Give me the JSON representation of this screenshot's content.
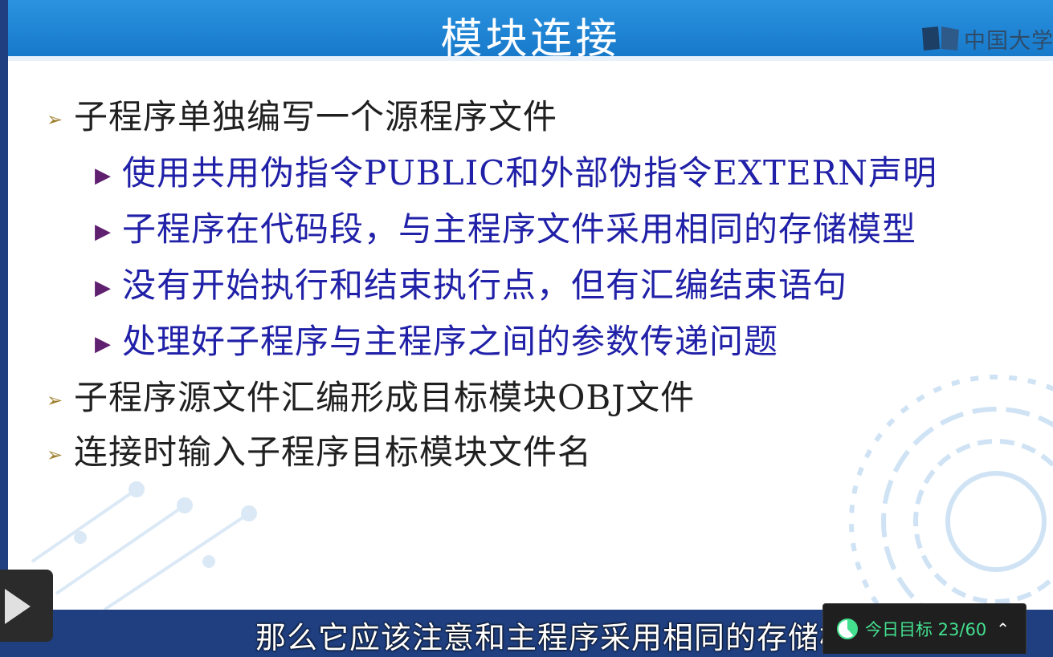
{
  "slide": {
    "title": "模块连接",
    "logo_text": "中国大学",
    "bullets": [
      {
        "level": 1,
        "text": "子程序单独编写一个源程序文件"
      },
      {
        "level": 2,
        "text": "使用共用伪指令PUBLIC和外部伪指令EXTERN声明"
      },
      {
        "level": 2,
        "text": "子程序在代码段，与主程序文件采用相同的存储模型"
      },
      {
        "level": 2,
        "text": "没有开始执行和结束执行点，但有汇编结束语句"
      },
      {
        "level": 2,
        "text": "处理好子程序与主程序之间的参数传递问题"
      },
      {
        "level": 1,
        "text": "子程序源文件汇编形成目标模块OBJ文件"
      },
      {
        "level": 1,
        "text": "连接时输入子程序目标模块文件名"
      }
    ]
  },
  "player": {
    "subtitle": "那么它应该注意和主程序采用相同的存储模",
    "goal_label": "今日目标 23/60",
    "goal_progress": 0.3833
  },
  "colors": {
    "title_bar": "#1f84d6",
    "level2_text": "#2020a8",
    "goal_text": "#43e08f"
  },
  "icons": [
    "logo-book-icon",
    "play-icon",
    "pie-progress-icon",
    "chevron-up-icon"
  ]
}
